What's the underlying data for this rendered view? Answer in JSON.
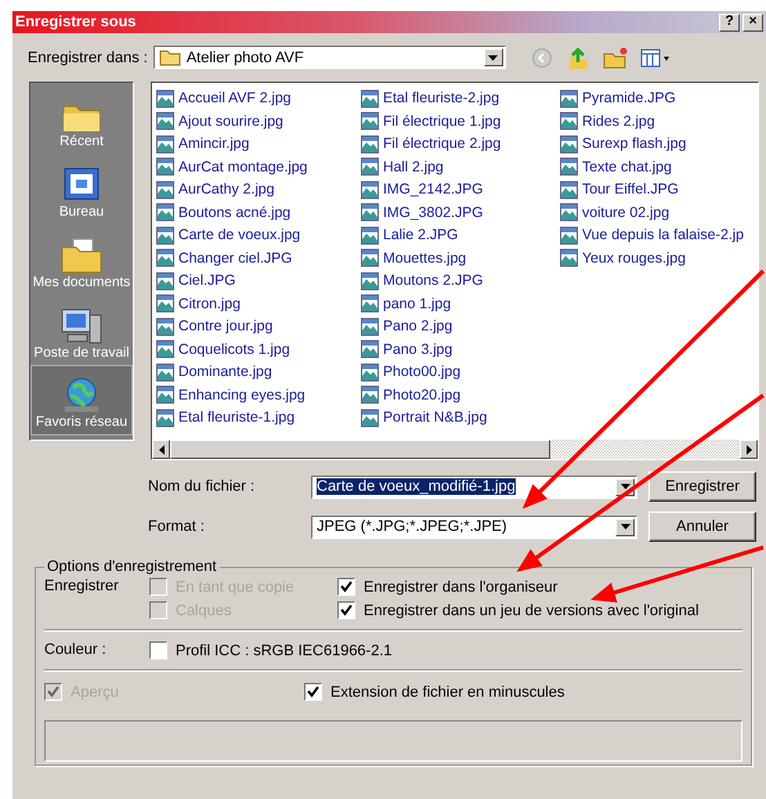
{
  "window": {
    "title": "Enregistrer sous",
    "help_button": "?",
    "close_button": "×"
  },
  "look_in": {
    "label": "Enregistrer dans :",
    "value": "Atelier photo AVF"
  },
  "places": [
    {
      "label": "Récent",
      "kind": "recent",
      "selected": false
    },
    {
      "label": "Bureau",
      "kind": "desktop",
      "selected": false
    },
    {
      "label": "Mes documents",
      "kind": "documents",
      "selected": false
    },
    {
      "label": "Poste de travail",
      "kind": "computer",
      "selected": false
    },
    {
      "label": "Favoris réseau",
      "kind": "network",
      "selected": true
    }
  ],
  "files": [
    "Accueil AVF 2.jpg",
    "Ajout sourire.jpg",
    "Amincir.jpg",
    "AurCat montage.jpg",
    "AurCathy 2.jpg",
    "Boutons acné.jpg",
    "Carte de voeux.jpg",
    "Changer ciel.JPG",
    "Ciel.JPG",
    "Citron.jpg",
    "Contre jour.jpg",
    "Coquelicots 1.jpg",
    "Dominante.jpg",
    "Enhancing eyes.jpg",
    "Etal fleuriste-1.jpg",
    "Etal fleuriste-2.jpg",
    "Fil électrique 1.jpg",
    "Fil électrique 2.jpg",
    "Hall 2.jpg",
    "IMG_2142.JPG",
    "IMG_3802.JPG",
    "Lalie 2.JPG",
    "Mouettes.jpg",
    "Moutons 2.JPG",
    "pano 1.jpg",
    "Pano 2.jpg",
    "Pano 3.jpg",
    "Photo00.jpg",
    "Photo20.jpg",
    "Portrait N&B.jpg",
    "Pyramide.JPG",
    "Rides 2.jpg",
    "Surexp flash.jpg",
    "Texte chat.jpg",
    "Tour Eiffel.JPG",
    "voiture 02.jpg",
    "Vue depuis la falaise-2.jp",
    "Yeux rouges.jpg"
  ],
  "filename": {
    "label": "Nom du fichier :",
    "value": "Carte de voeux_modifié-1.jpg"
  },
  "format": {
    "label": "Format :",
    "value": "JPEG (*.JPG;*.JPEG;*.JPE)"
  },
  "buttons": [
    "Enregistrer",
    "Annuler"
  ],
  "options": {
    "title": "Options d'enregistrement",
    "save_label": "Enregistrer",
    "save_left": [
      {
        "label": "En tant que copie",
        "checked": false,
        "disabled": true
      },
      {
        "label": "Calques",
        "checked": false,
        "disabled": true
      }
    ],
    "save_right": [
      {
        "label": "Enregistrer dans l'organiseur",
        "checked": true,
        "disabled": false
      },
      {
        "label": "Enregistrer dans un jeu de versions avec l'original",
        "checked": true,
        "disabled": false
      }
    ],
    "color_label": "Couleur :",
    "icc": {
      "label": "Profil ICC : sRGB IEC61966-2.1",
      "checked": false,
      "disabled": false
    },
    "preview": {
      "label": "Aperçu",
      "checked": true,
      "disabled": true
    },
    "lowercase": {
      "label": "Extension de fichier en minuscules",
      "checked": true,
      "disabled": false
    }
  }
}
